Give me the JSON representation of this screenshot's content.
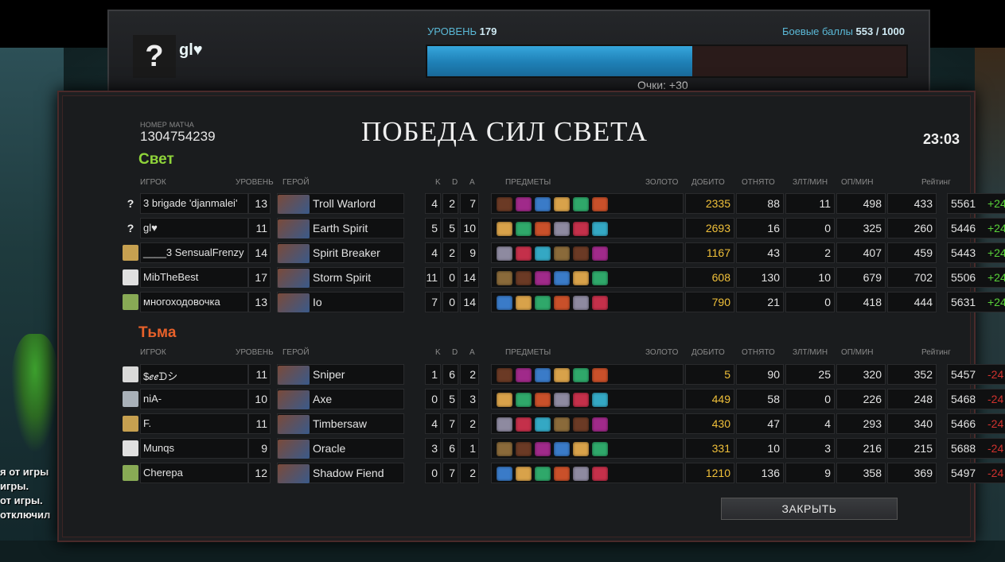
{
  "header": {
    "level_label": "УРОВЕНЬ",
    "level_value": "179",
    "battle_points_label": "Боевые баллы",
    "battle_points_value": "553 / 1000",
    "battle_points_progress": 0.553,
    "avatar_glyph": "?",
    "player_name": "gl♥",
    "points_text": "Очки: +30"
  },
  "side_messages": [
    "я от игры",
    "игры.",
    "от игры.",
    "отключил"
  ],
  "match": {
    "label": "НОМЕР МАТЧА",
    "number": "1304754239",
    "title": "ПОБЕДА СИЛ СВЕТА",
    "duration": "23:03"
  },
  "columns": {
    "player": "ИГРОК",
    "level": "УРОВЕНЬ",
    "hero": "ГЕРОЙ",
    "k": "K",
    "d": "D",
    "a": "A",
    "items": "ПРЕДМЕТЫ",
    "gold": "ЗОЛОТО",
    "last_hits": "ДОБИТО",
    "denies": "ОТНЯТО",
    "gpm": "ЗЛТ/МИН",
    "xpm": "ОП/МИН",
    "rating": "Рейтинг"
  },
  "radiant": {
    "name": "Свет",
    "players": [
      {
        "icon": "?",
        "name": "3 brigade 'djanmalei'",
        "level": "13",
        "hero": "Troll Warlord",
        "k": "4",
        "d": "2",
        "a": "7",
        "gold": "2335",
        "lh": "88",
        "dn": "11",
        "gpm": "498",
        "xpm": "433",
        "rating": "5561",
        "delta": "+24"
      },
      {
        "icon": "?",
        "name": "gl♥",
        "level": "11",
        "hero": "Earth Spirit",
        "k": "5",
        "d": "5",
        "a": "10",
        "gold": "2693",
        "lh": "16",
        "dn": "0",
        "gpm": "325",
        "xpm": "260",
        "rating": "5446",
        "delta": "+24"
      },
      {
        "icon": "",
        "name": "____3 SensualFrenzy",
        "level": "14",
        "hero": "Spirit Breaker",
        "k": "4",
        "d": "2",
        "a": "9",
        "gold": "1167",
        "lh": "43",
        "dn": "2",
        "gpm": "407",
        "xpm": "459",
        "rating": "5443",
        "delta": "+24"
      },
      {
        "icon": "",
        "name": "MibTheBest",
        "level": "17",
        "hero": "Storm Spirit",
        "k": "11",
        "d": "0",
        "a": "14",
        "gold": "608",
        "lh": "130",
        "dn": "10",
        "gpm": "679",
        "xpm": "702",
        "rating": "5506",
        "delta": "+24"
      },
      {
        "icon": "",
        "name": "многоходовочка",
        "level": "13",
        "hero": "Io",
        "k": "7",
        "d": "0",
        "a": "14",
        "gold": "790",
        "lh": "21",
        "dn": "0",
        "gpm": "418",
        "xpm": "444",
        "rating": "5631",
        "delta": "+24"
      }
    ]
  },
  "dire": {
    "name": "Тьма",
    "players": [
      {
        "icon": "",
        "name": "$ℯℯᗪシ",
        "level": "11",
        "hero": "Sniper",
        "k": "1",
        "d": "6",
        "a": "2",
        "gold": "5",
        "lh": "90",
        "dn": "25",
        "gpm": "320",
        "xpm": "352",
        "rating": "5457",
        "delta": "-24"
      },
      {
        "icon": "",
        "name": "niA-",
        "level": "10",
        "hero": "Axe",
        "k": "0",
        "d": "5",
        "a": "3",
        "gold": "449",
        "lh": "58",
        "dn": "0",
        "gpm": "226",
        "xpm": "248",
        "rating": "5468",
        "delta": "-24"
      },
      {
        "icon": "",
        "name": "F.",
        "level": "11",
        "hero": "Timbersaw",
        "k": "4",
        "d": "7",
        "a": "2",
        "gold": "430",
        "lh": "47",
        "dn": "4",
        "gpm": "293",
        "xpm": "340",
        "rating": "5466",
        "delta": "-24"
      },
      {
        "icon": "",
        "name": "Munqs",
        "level": "9",
        "hero": "Oracle",
        "k": "3",
        "d": "6",
        "a": "1",
        "gold": "331",
        "lh": "10",
        "dn": "3",
        "gpm": "216",
        "xpm": "215",
        "rating": "5688",
        "delta": "-24"
      },
      {
        "icon": "",
        "name": "Cherepa",
        "level": "12",
        "hero": "Shadow Fiend",
        "k": "0",
        "d": "7",
        "a": "2",
        "gold": "1210",
        "lh": "136",
        "dn": "9",
        "gpm": "358",
        "xpm": "369",
        "rating": "5497",
        "delta": "-24"
      }
    ]
  },
  "close_button": "ЗАКРЫТЬ",
  "colors": {
    "radiant": "#8fd43a",
    "dire": "#e8612a",
    "gold": "#f0c03a",
    "win_delta": "#59d239",
    "loss_delta": "#d0322e",
    "xp_bar": "#2a8cc8"
  }
}
